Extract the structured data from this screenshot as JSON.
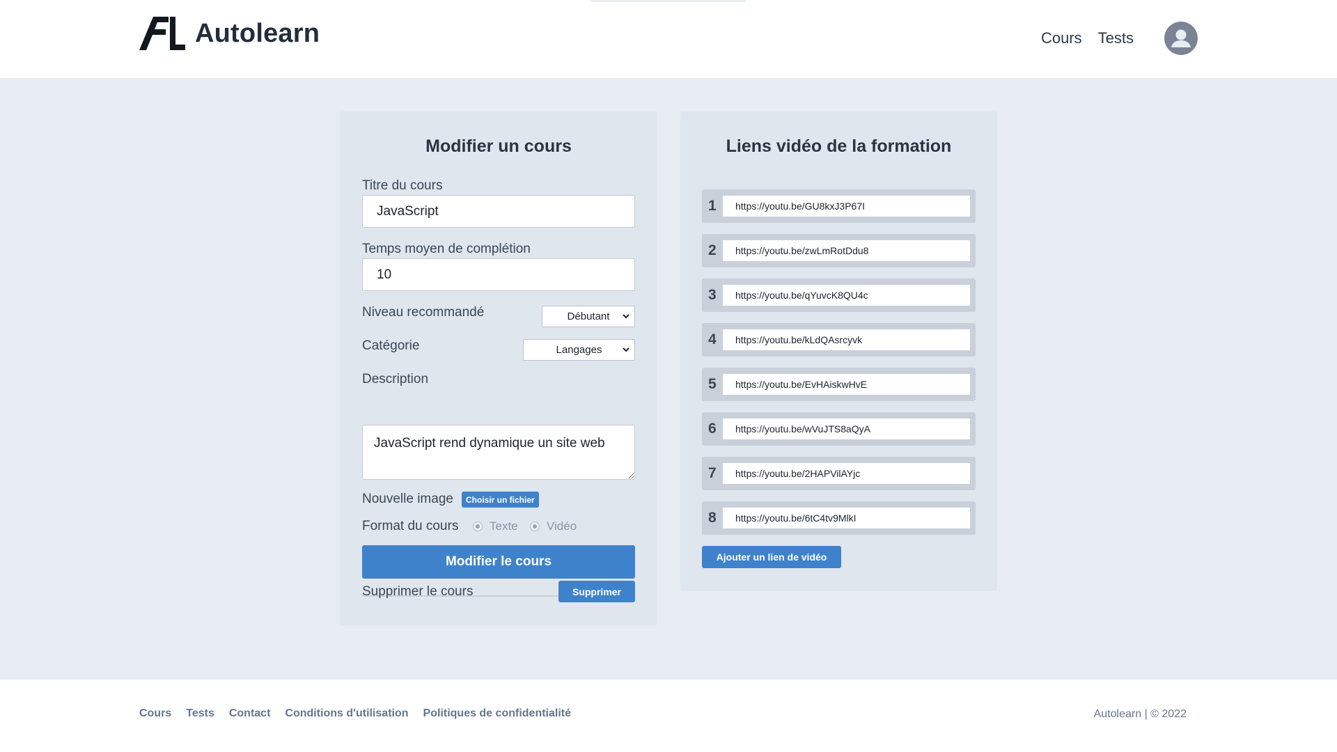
{
  "header": {
    "brand": "Autolearn",
    "logo_mark": "AL",
    "nav": [
      {
        "label": "Cours"
      },
      {
        "label": "Tests"
      }
    ],
    "avatar_icon": "user-avatar-icon"
  },
  "edit_course": {
    "title": "Modifier un cours",
    "course_title_label": "Titre du cours",
    "course_title_value": "JavaScript",
    "avg_time_label": "Temps moyen de complétion",
    "avg_time_value": "10",
    "level_label": "Niveau recommandé",
    "level_value": "Débutant",
    "category_label": "Catégorie",
    "category_value": "Langages",
    "description_label": "Description",
    "description_value": "JavaScript rend dynamique un site web",
    "image_label": "Nouvelle image",
    "file_button": "Choisir un fichier",
    "format_label": "Format du cours",
    "format_options": [
      {
        "label": "Texte"
      },
      {
        "label": "Vidéo"
      }
    ],
    "submit_button": "Modifier le cours",
    "delete_label": "Supprimer le cours",
    "delete_button": "Supprimer"
  },
  "video_links": {
    "title": "Liens vidéo de la formation",
    "links": [
      {
        "num": "1",
        "url": "https://youtu.be/GU8kxJ3P67I"
      },
      {
        "num": "2",
        "url": "https://youtu.be/zwLmRotDdu8"
      },
      {
        "num": "3",
        "url": "https://youtu.be/qYuvcK8QU4c"
      },
      {
        "num": "4",
        "url": "https://youtu.be/kLdQAsrcyvk"
      },
      {
        "num": "5",
        "url": "https://youtu.be/EvHAiskwHvE"
      },
      {
        "num": "6",
        "url": "https://youtu.be/wVuJTS8aQyA"
      },
      {
        "num": "7",
        "url": "https://youtu.be/2HAPVilAYjc"
      },
      {
        "num": "8",
        "url": "https://youtu.be/6tC4tv9MlkI"
      }
    ],
    "add_button": "Ajouter un lien de vidéo"
  },
  "footer": {
    "links": [
      {
        "label": "Cours"
      },
      {
        "label": "Tests"
      },
      {
        "label": "Contact"
      },
      {
        "label": "Conditions d'utilisation"
      },
      {
        "label": "Politiques de confidentialité"
      }
    ],
    "copyright": "Autolearn | © 2022"
  },
  "colors": {
    "primary": "#3f82cc",
    "page_bg": "#e8edf3",
    "panel_bg": "#e0e6ee",
    "heading": "#2a3444",
    "footer_text": "#67768a"
  }
}
